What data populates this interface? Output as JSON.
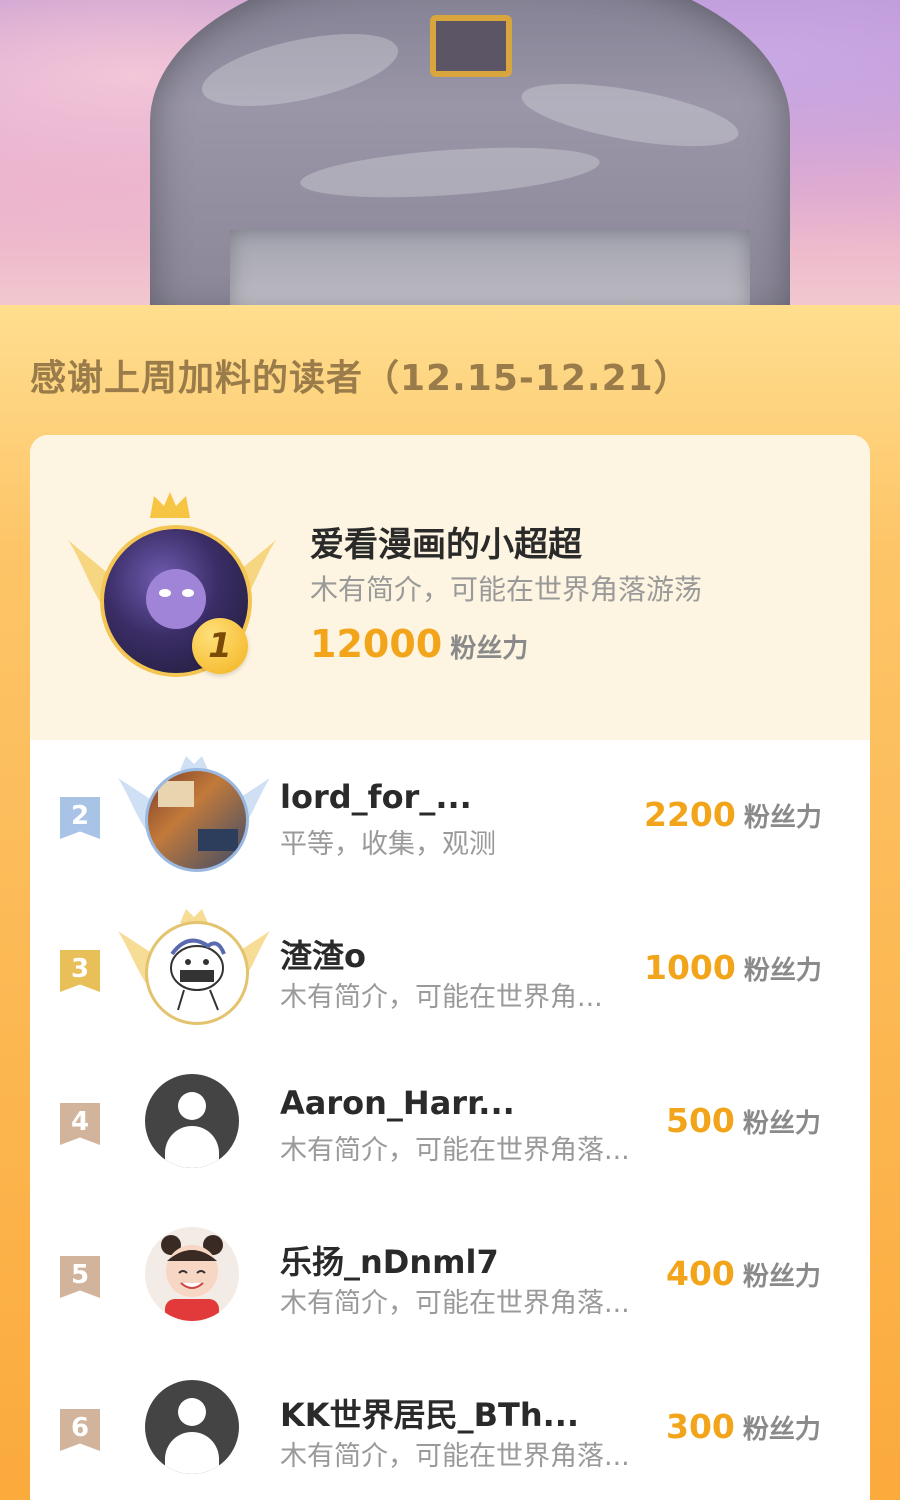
{
  "header": {
    "title": "感谢上周加料的读者（12.15-12.21）"
  },
  "top_reader": {
    "rank": "1",
    "name": "爱看漫画的小超超",
    "bio": "木有简介，可能在世界角落游荡",
    "score": "12000",
    "unit": "粉丝力"
  },
  "readers": [
    {
      "rank": "2",
      "name": "lord_for_...",
      "bio": "平等，收集，观测",
      "score": "2200",
      "unit": "粉丝力"
    },
    {
      "rank": "3",
      "name": "渣渣o",
      "bio": "木有简介，可能在世界角...",
      "score": "1000",
      "unit": "粉丝力"
    },
    {
      "rank": "4",
      "name": "Aaron_Harr...",
      "bio": "木有简介，可能在世界角落...",
      "score": "500",
      "unit": "粉丝力"
    },
    {
      "rank": "5",
      "name": "乐扬_nDnml7",
      "bio": "木有简介，可能在世界角落...",
      "score": "400",
      "unit": "粉丝力"
    },
    {
      "rank": "6",
      "name": "KK世界居民_BTh...",
      "bio": "木有简介，可能在世界角落...",
      "score": "300",
      "unit": "粉丝力"
    }
  ],
  "colors": {
    "score": "#f2a51a",
    "rank2": "#8fb0d6",
    "rank3": "#e0b24a",
    "rank_other": "#c8a487"
  }
}
